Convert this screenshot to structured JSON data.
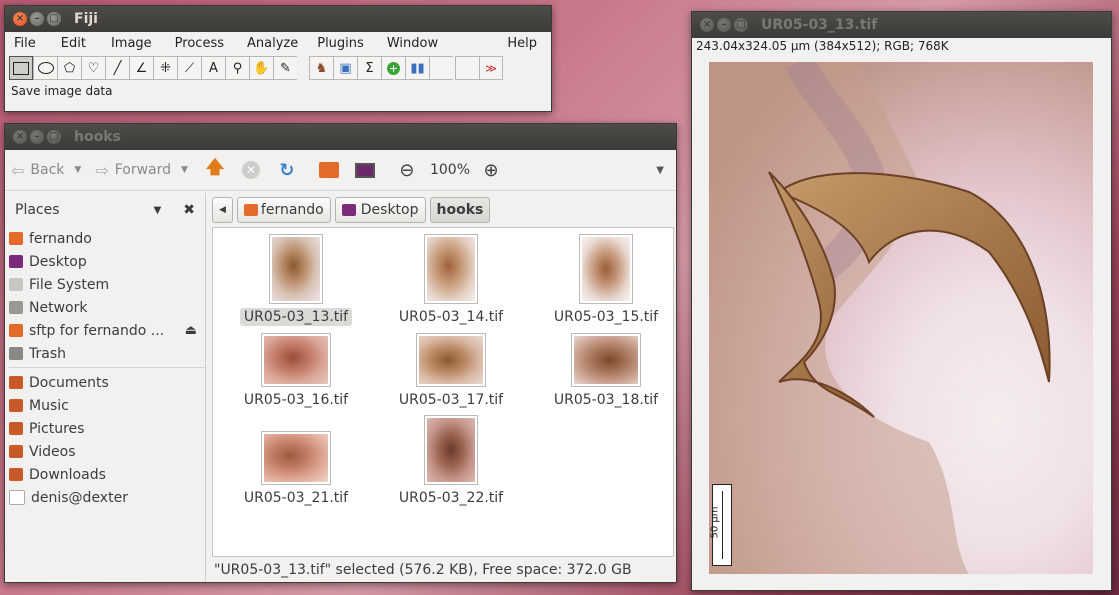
{
  "fiji": {
    "title": "Fiji",
    "menus": [
      "File",
      "Edit",
      "Image",
      "Process",
      "Analyze",
      "Plugins",
      "Window",
      "Help"
    ],
    "tools": [
      "rectangle-tool",
      "oval-tool",
      "polygon-tool",
      "freehand-tool",
      "line-tool",
      "angle-tool",
      "point-tool",
      "wand-tool",
      "text-tool",
      "magnifier-tool",
      "hand-tool",
      "dropper-tool",
      "developer-menu",
      "stacks-menu",
      "lut-menu",
      "sigma-menu",
      "plus-menu",
      "histogram-menu",
      "blank-tool",
      "blank-tool-2",
      "more-tools"
    ],
    "status": "Save image data"
  },
  "files": {
    "title": "hooks",
    "nav": {
      "back": "Back",
      "forward": "Forward",
      "zoom": "100%"
    },
    "sidebar": {
      "header": "Places",
      "places": [
        "fernando",
        "Desktop",
        "File System",
        "Network",
        "sftp for fernando ...",
        "Trash"
      ],
      "bookmarks": [
        "Documents",
        "Music",
        "Pictures",
        "Videos",
        "Downloads",
        "denis@dexter"
      ]
    },
    "path": [
      "fernando",
      "Desktop",
      "hooks"
    ],
    "items": [
      "UR05-03_13.tif",
      "UR05-03_14.tif",
      "UR05-03_15.tif",
      "UR05-03_16.tif",
      "UR05-03_17.tif",
      "UR05-03_18.tif",
      "UR05-03_21.tif",
      "UR05-03_22.tif"
    ],
    "selected": "UR05-03_13.tif",
    "status": "\"UR05-03_13.tif\" selected (576.2 KB), Free space: 372.0 GB"
  },
  "image": {
    "title": "UR05-03_13.tif",
    "info": "243.04x324.05 µm (384x512); RGB; 768K",
    "scale_label": "50 µm"
  },
  "colors": {
    "accent": "#df4a16",
    "titlebar": "#3c3b37",
    "selection": "#dcdad6"
  }
}
